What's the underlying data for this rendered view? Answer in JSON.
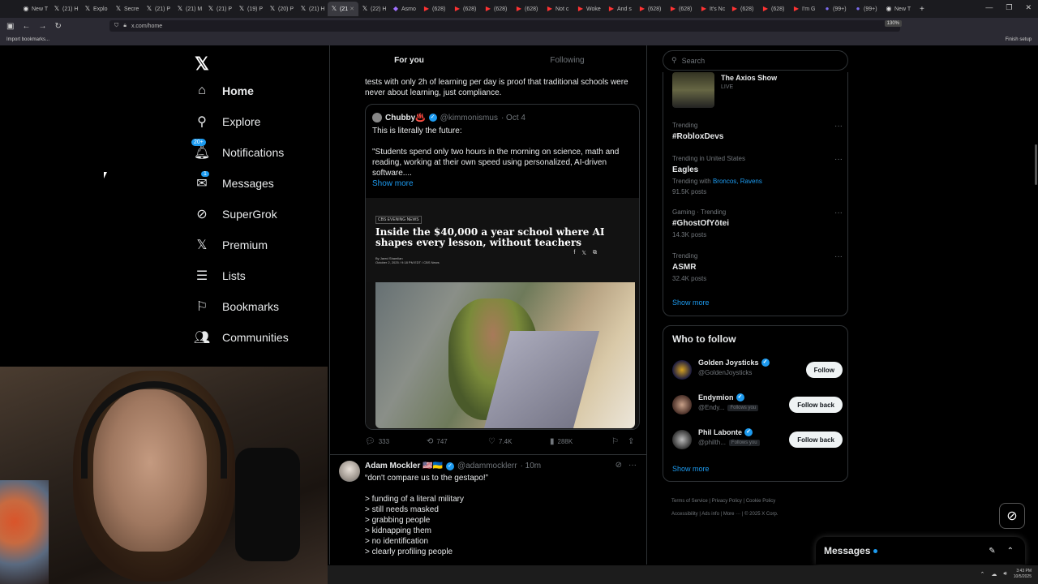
{
  "browser": {
    "tabs": [
      {
        "label": "New T",
        "icon": "firefox-icon"
      },
      {
        "label": "(21) H",
        "icon": "x-logo-icon"
      },
      {
        "label": "Explo",
        "icon": "x-logo-icon"
      },
      {
        "label": "Secre",
        "icon": "x-logo-icon"
      },
      {
        "label": "(21) P",
        "icon": "x-logo-icon"
      },
      {
        "label": "(21) M",
        "icon": "x-logo-icon"
      },
      {
        "label": "(21) P",
        "icon": "x-logo-icon"
      },
      {
        "label": "(19) P",
        "icon": "x-logo-icon"
      },
      {
        "label": "(20) P",
        "icon": "x-logo-icon"
      },
      {
        "label": "(21) H",
        "icon": "x-logo-icon"
      },
      {
        "label": "(21",
        "icon": "x-logo-icon",
        "active": true
      },
      {
        "label": "(22) H",
        "icon": "x-logo-icon"
      },
      {
        "label": "Asmo",
        "icon": "twitch-icon"
      },
      {
        "label": "(628)",
        "icon": "youtube-icon"
      },
      {
        "label": "(628)",
        "icon": "youtube-icon"
      },
      {
        "label": "(628)",
        "icon": "youtube-icon"
      },
      {
        "label": "(628)",
        "icon": "youtube-icon"
      },
      {
        "label": "Not c",
        "icon": "youtube-icon"
      },
      {
        "label": "Woke",
        "icon": "youtube-icon"
      },
      {
        "label": "And s",
        "icon": "youtube-icon"
      },
      {
        "label": "(628)",
        "icon": "youtube-icon"
      },
      {
        "label": "(628)",
        "icon": "youtube-icon"
      },
      {
        "label": "It's Nc",
        "icon": "youtube-icon"
      },
      {
        "label": "(628)",
        "icon": "youtube-icon"
      },
      {
        "label": "(628)",
        "icon": "youtube-icon"
      },
      {
        "label": "I'm G",
        "icon": "youtube-icon"
      },
      {
        "label": "(99+)",
        "icon": "discord-icon"
      },
      {
        "label": "(99+)",
        "icon": "discord-icon"
      },
      {
        "label": "New T",
        "icon": "firefox-icon"
      }
    ],
    "url": "x.com/home",
    "zoom": "130%",
    "bookmark_label": "Import bookmarks...",
    "finish_setup": "Finish setup"
  },
  "nav": {
    "items": [
      {
        "label": "Home",
        "icon": "home-icon",
        "glyph": "⌂",
        "active": true
      },
      {
        "label": "Explore",
        "icon": "search-icon",
        "glyph": "⚲"
      },
      {
        "label": "Notifications",
        "icon": "bell-icon",
        "glyph": "🔔︎",
        "badge": "20+"
      },
      {
        "label": "Messages",
        "icon": "envelope-icon",
        "glyph": "✉",
        "badge": "1"
      },
      {
        "label": "SuperGrok",
        "icon": "grok-icon",
        "glyph": "⊘"
      },
      {
        "label": "Premium",
        "icon": "x-logo-icon",
        "glyph": "𝕏"
      },
      {
        "label": "Lists",
        "icon": "list-icon",
        "glyph": "☰"
      },
      {
        "label": "Bookmarks",
        "icon": "bookmark-icon",
        "glyph": "⚐"
      },
      {
        "label": "Communities",
        "icon": "people-icon",
        "glyph": "👥︎"
      }
    ]
  },
  "feed": {
    "tabs": [
      "For you",
      "Following"
    ],
    "post1_text": "tests with only 2h of learning per day is proof that traditional schools were never about learning, just compliance.",
    "quote": {
      "name": "Chubby♨️",
      "handle": "@kimmonismus",
      "date": "· Oct 4",
      "line1": "This is literally the future:",
      "body": "\"Students spend only two hours in the morning on science, math and reading, working at their own speed using personalized, AI-driven software....",
      "show_more": "Show more",
      "article_tag": "CBS EVENING NEWS",
      "article_title": "Inside the $40,000 a year school where AI shapes every lesson, without teachers",
      "byline_author": "By Jared Shamlian",
      "byline_date": "October 2, 2025 / 9:18 PM EDT / CBS News"
    },
    "actions": {
      "replies": "333",
      "reposts": "747",
      "likes": "7.4K",
      "views": "288K"
    },
    "post2": {
      "name": "Adam Mockler 🇺🇸🇺🇦",
      "handle": "@adammocklerr",
      "time": "· 10m",
      "lines": [
        "“don't compare us to the gestapo!”",
        "",
        "> funding of a literal military",
        "> still needs masked",
        "> grabbing people",
        "> kidnapping them",
        "> no identification",
        "> clearly profiling people"
      ]
    }
  },
  "right": {
    "search_placeholder": "Search",
    "live": {
      "title": "The Axios Show",
      "status": "LIVE"
    },
    "trends": [
      {
        "context": "Trending",
        "title": "#RobloxDevs",
        "sub": ""
      },
      {
        "context": "Trending in United States",
        "title": "Eagles",
        "sub_prefix": "Trending with ",
        "sub_links": "Broncos, Ravens",
        "posts": "91.5K posts"
      },
      {
        "context": "Gaming · Trending",
        "title": "#GhostOfYōtei",
        "posts": "14.3K posts"
      },
      {
        "context": "Trending",
        "title": "ASMR",
        "posts": "32.4K posts"
      }
    ],
    "show_more": "Show more",
    "who_to_follow_title": "Who to follow",
    "follow": [
      {
        "name": "Golden Joysticks",
        "handle": "@GoldenJoysticks",
        "follows_you": "",
        "button": "Follow"
      },
      {
        "name": "Endymion",
        "handle": "@Endy...",
        "follows_you": "Follows you",
        "button": "Follow back"
      },
      {
        "name": "Phil Labonte",
        "handle": "@philth...",
        "follows_you": "Follows you",
        "button": "Follow back"
      }
    ],
    "footer": [
      "Terms of Service",
      "Privacy Policy",
      "Cookie Policy",
      "Accessibility",
      "Ads info",
      "More ···",
      "© 2025 X Corp."
    ]
  },
  "messages_drawer": {
    "title": "Messages"
  },
  "taskbar": {
    "time": "3:43 PM",
    "date": "10/5/2025"
  }
}
